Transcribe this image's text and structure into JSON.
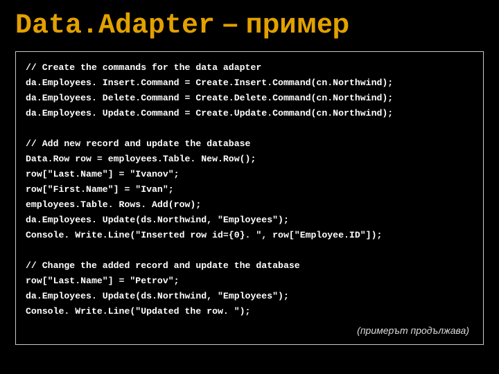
{
  "title": {
    "code_part": "Data.Adapter",
    "dash": " – ",
    "word": "пример"
  },
  "code": {
    "block1": [
      "// Create the commands for the data adapter",
      "da.Employees. Insert.Command = Create.Insert.Command(cn.Northwind);",
      "da.Employees. Delete.Command = Create.Delete.Command(cn.Northwind);",
      "da.Employees. Update.Command = Create.Update.Command(cn.Northwind);"
    ],
    "block2": [
      "// Add new record and update the database",
      "Data.Row row = employees.Table. New.Row();",
      "row[\"Last.Name\"] = \"Ivanov\";",
      "row[\"First.Name\"] = \"Ivan\";",
      "employees.Table. Rows. Add(row);",
      "da.Employees. Update(ds.Northwind, \"Employees\");",
      "Console. Write.Line(\"Inserted row id={0}. \", row[\"Employee.ID\"]);"
    ],
    "block3": [
      "// Change the added record and update the database",
      "row[\"Last.Name\"] = \"Petrov\";",
      "da.Employees. Update(ds.Northwind, \"Employees\");",
      "Console. Write.Line(\"Updated the row. \");"
    ]
  },
  "continuation_note": "(примерът продължава)"
}
